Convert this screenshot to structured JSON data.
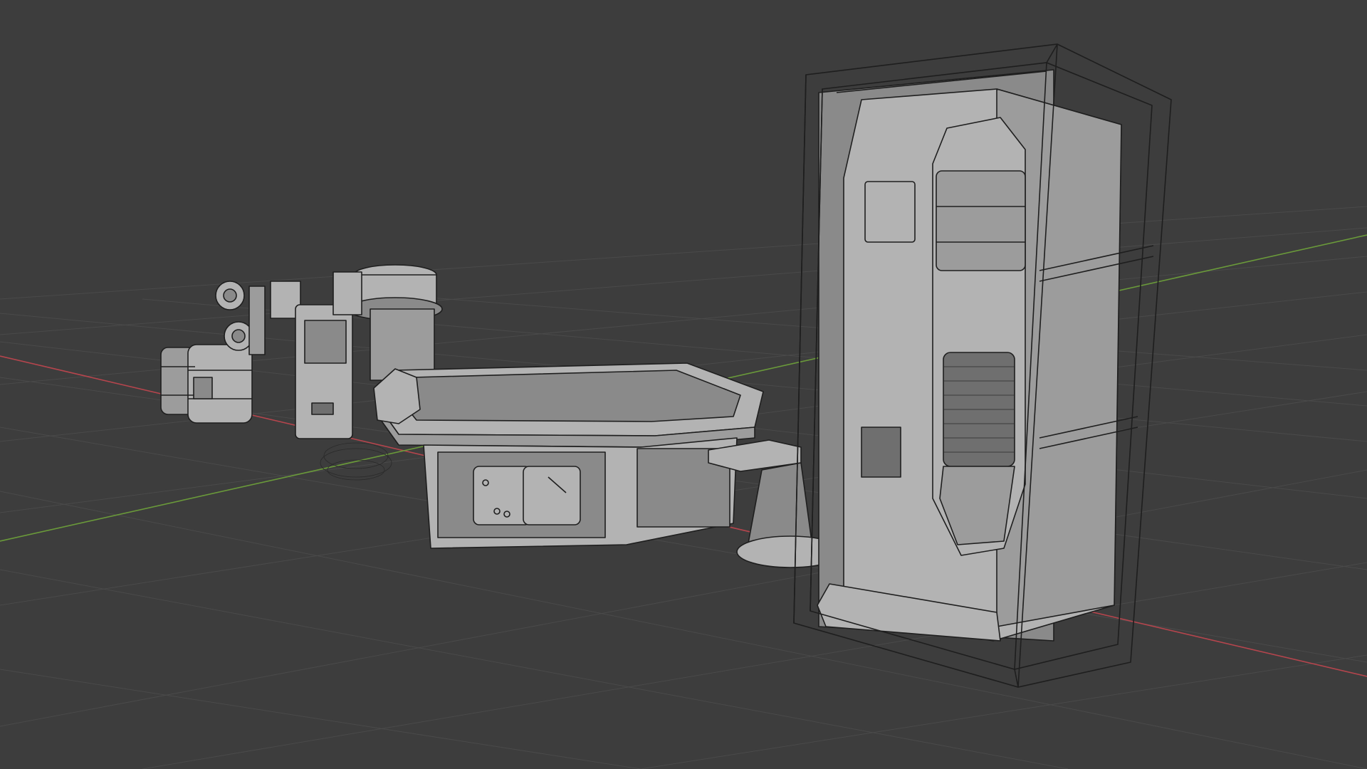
{
  "scene": {
    "objects": [
      {
        "id": "barrels"
      },
      {
        "id": "lamp-cluster"
      },
      {
        "id": "generator"
      },
      {
        "id": "hex-console-table"
      },
      {
        "id": "stool"
      },
      {
        "id": "reactor-cabinet"
      }
    ]
  },
  "colors": {
    "background": "#3d3d3d",
    "grid": "#4a4a4a",
    "x_axis": "#b5454d",
    "y_axis": "#6a9a3a",
    "mesh_fill": "#9c9c9c",
    "wire": "#1e1e1e"
  }
}
